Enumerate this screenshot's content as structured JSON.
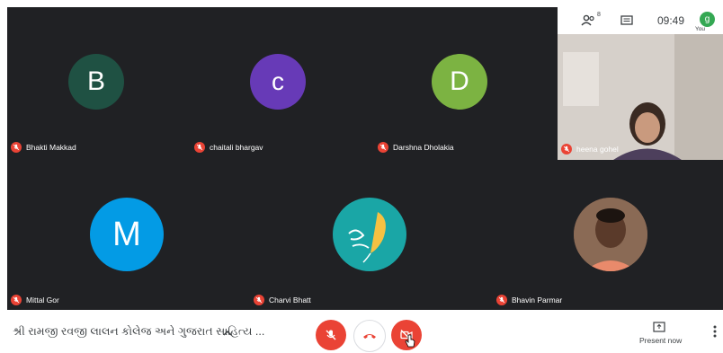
{
  "participants": [
    {
      "name": "Bhakti Makkad",
      "initial": "B",
      "color": "#1f5143"
    },
    {
      "name": "chaitali bhargav",
      "initial": "c",
      "color": "#673ab7"
    },
    {
      "name": "Darshna Dholakia",
      "initial": "D",
      "color": "#7cb342"
    },
    {
      "name": "Mittal Gor",
      "initial": "M",
      "color": "#039be5"
    },
    {
      "name": "Charvi Bhatt",
      "initial": "",
      "color": "#1aa6a6"
    },
    {
      "name": "Bhavin Parmar",
      "initial": "",
      "color": "#6d4c3d"
    }
  ],
  "self_view": {
    "name": "heena gohel",
    "time": "09:49",
    "people_count": "8",
    "you_label": "You",
    "avatar_initial": "g"
  },
  "bottom_bar": {
    "meeting_title": "શ્રી રામજી રવજી લાલન કોલેજ અને ગુજરાત સાહિત્ય ...",
    "present_now_label": "Present now",
    "accent_red": "#ea4335"
  }
}
